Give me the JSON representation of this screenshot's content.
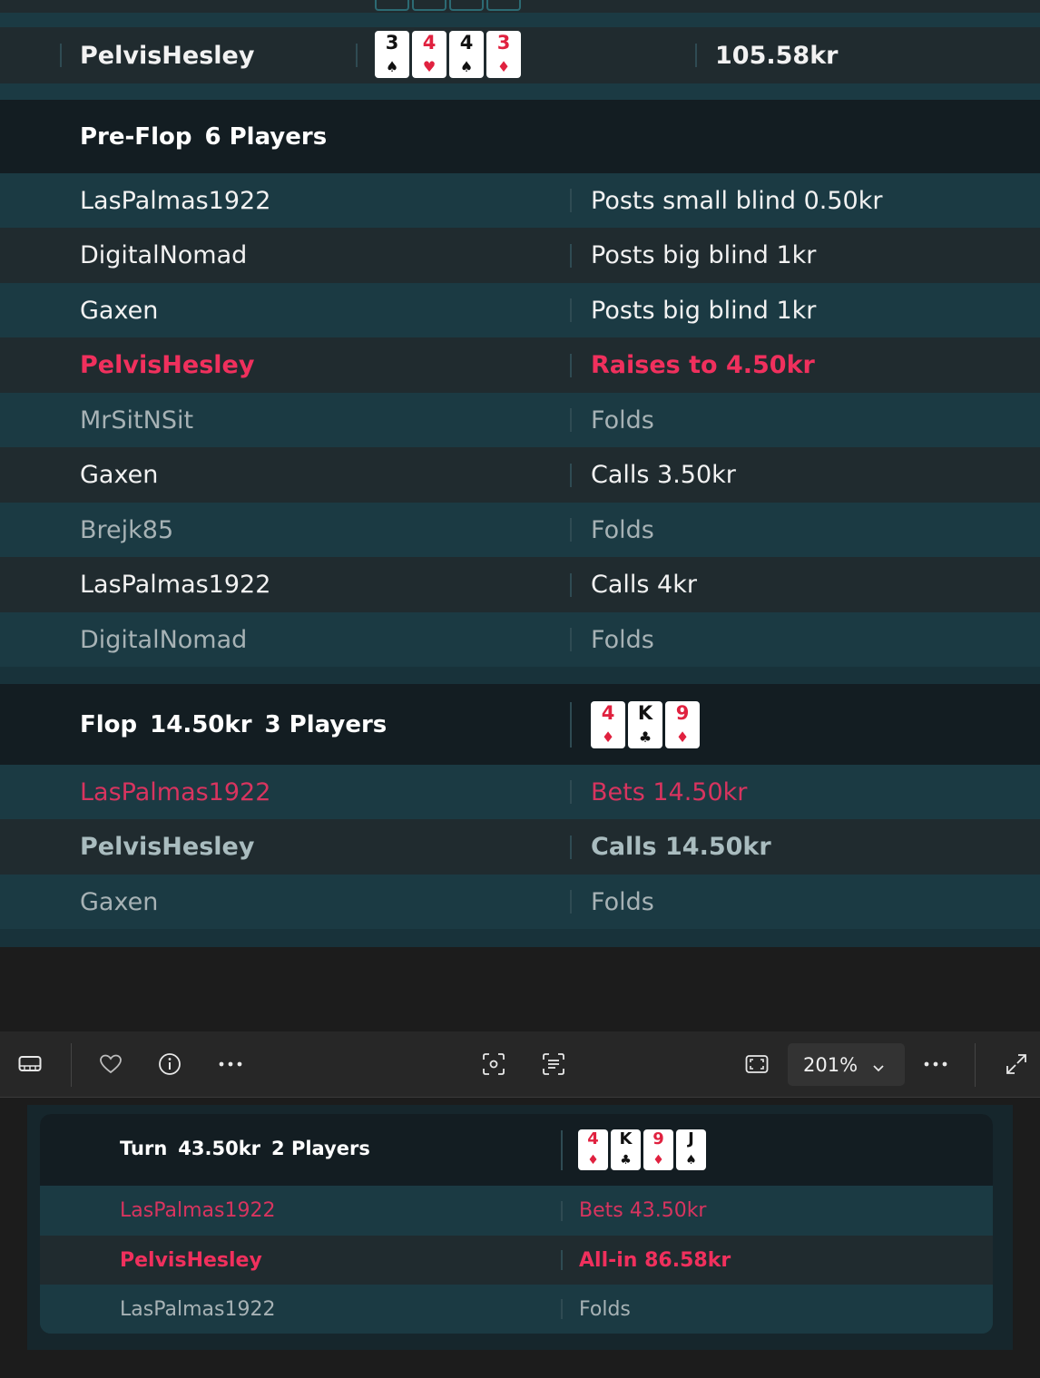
{
  "summary_row": {
    "player": "PelvisHesley",
    "cards": [
      {
        "rank": "3",
        "suit": "♠",
        "color": "black"
      },
      {
        "rank": "4",
        "suit": "♥",
        "color": "red"
      },
      {
        "rank": "4",
        "suit": "♠",
        "color": "black"
      },
      {
        "rank": "3",
        "suit": "♦",
        "color": "red"
      }
    ],
    "amount": "105.58kr"
  },
  "preflop": {
    "label": "Pre-Flop",
    "players": "6 Players",
    "actions": [
      {
        "player": "LasPalmas1922",
        "action": "Posts small blind 0.50kr"
      },
      {
        "player": "DigitalNomad",
        "action": "Posts big blind 1kr"
      },
      {
        "player": "Gaxen",
        "action": "Posts big blind 1kr"
      },
      {
        "player": "PelvisHesley",
        "action": "Raises to 4.50kr"
      },
      {
        "player": "MrSitNSit",
        "action": "Folds"
      },
      {
        "player": "Gaxen",
        "action": "Calls 3.50kr"
      },
      {
        "player": "Brejk85",
        "action": "Folds"
      },
      {
        "player": "LasPalmas1922",
        "action": "Calls 4kr"
      },
      {
        "player": "DigitalNomad",
        "action": "Folds"
      }
    ]
  },
  "flop": {
    "label": "Flop",
    "pot": "14.50kr",
    "players": "3 Players",
    "cards": [
      {
        "rank": "4",
        "suit": "♦",
        "color": "red"
      },
      {
        "rank": "K",
        "suit": "♣",
        "color": "black"
      },
      {
        "rank": "9",
        "suit": "♦",
        "color": "red"
      }
    ],
    "actions": [
      {
        "player": "LasPalmas1922",
        "action": "Bets 14.50kr"
      },
      {
        "player": "PelvisHesley",
        "action": "Calls 14.50kr"
      },
      {
        "player": "Gaxen",
        "action": "Folds"
      }
    ]
  },
  "toolbar": {
    "zoom": "201%",
    "icons": [
      "filmstrip-icon",
      "heart-icon",
      "info-icon",
      "more-icon",
      "visual-search-icon",
      "text-extract-icon",
      "fit-screen-icon",
      "more-icon",
      "expand-icon"
    ]
  },
  "turn": {
    "label": "Turn",
    "pot": "43.50kr",
    "players": "2 Players",
    "cards": [
      {
        "rank": "4",
        "suit": "♦",
        "color": "red"
      },
      {
        "rank": "K",
        "suit": "♣",
        "color": "black"
      },
      {
        "rank": "9",
        "suit": "♦",
        "color": "red"
      },
      {
        "rank": "J",
        "suit": "♠",
        "color": "black"
      }
    ],
    "actions": [
      {
        "player": "LasPalmas1922",
        "action": "Bets 43.50kr"
      },
      {
        "player": "PelvisHesley",
        "action": "All-in 86.58kr"
      },
      {
        "player": "LasPalmas1922",
        "action": "Folds"
      }
    ]
  },
  "colors": {
    "accent_pink": "#f0305d",
    "row_teal": "#1b3a43",
    "row_dark": "#202b2f",
    "header_bg": "#131d22"
  }
}
